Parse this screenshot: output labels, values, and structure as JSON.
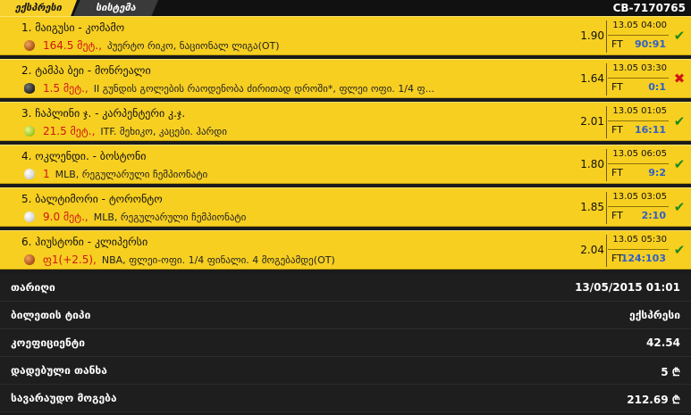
{
  "tabs": {
    "express": "ექსპრესი",
    "system": "სისტემა"
  },
  "ticket_id": "CB-7170765",
  "bets": [
    {
      "match": "1. მაიგუსი - კომამო",
      "sport": "basketball",
      "pick": "164.5 მეტ.,",
      "desc": "პუერტო რიკო, ნაციონალ ლიგა(OT)",
      "odds": "1.90",
      "datetime": "13.05 04:00",
      "ft": "FT",
      "score": "90:91",
      "status": "win",
      "status_icon": "✔"
    },
    {
      "match": "2. ტამპა ბეი - მონრეალი",
      "sport": "hockey",
      "pick": "1.5 მეტ.,",
      "desc": "II გუნდის გოლების რაოდენობა ძირითად დროში*, ფლეი ოფი. 1/4 ფ...",
      "odds": "1.64",
      "datetime": "13.05 03:30",
      "ft": "FT",
      "score": "0:1",
      "status": "lose",
      "status_icon": "✖"
    },
    {
      "match": "3. ჩაპლინი ჯ. - კარპენტერი კ.ჯ.",
      "sport": "tennis",
      "pick": "21.5 მეტ.,",
      "desc": "ITF. მეხიკო, კაცები. ჰარდი",
      "odds": "2.01",
      "datetime": "13.05 01:05",
      "ft": "FT",
      "score": "16:11",
      "status": "win",
      "status_icon": "✔"
    },
    {
      "match": "4. ოკლენდი. - ბოსტონი",
      "sport": "baseball",
      "pick": "1",
      "desc": "MLB, რეგულარული ჩემპიონატი",
      "odds": "1.80",
      "datetime": "13.05 06:05",
      "ft": "FT",
      "score": "9:2",
      "status": "win",
      "status_icon": "✔"
    },
    {
      "match": "5. ბალტიმორი - ტორონტო",
      "sport": "baseball",
      "pick": "9.0 მეტ.,",
      "desc": "MLB, რეგულარული ჩემპიონატი",
      "odds": "1.85",
      "datetime": "13.05 03:05",
      "ft": "FT",
      "score": "2:10",
      "status": "win",
      "status_icon": "✔"
    },
    {
      "match": "6. ჰიუსტონი - კლიპერსი",
      "sport": "basketball",
      "pick": "ფ1(+2.5),",
      "desc": "NBA, ფლეი-ოფი. 1/4 ფინალი. 4 მოგებამდე(OT)",
      "odds": "2.04",
      "datetime": "13.05 05:30",
      "ft": "FT",
      "score": "124:103",
      "status": "win",
      "status_icon": "✔"
    }
  ],
  "summary": [
    {
      "label": "თარიღი",
      "value": "13/05/2015 01:01"
    },
    {
      "label": "ბილეთის ტიპი",
      "value": "ექსპრესი"
    },
    {
      "label": "კოეფიციენტი",
      "value": "42.54"
    },
    {
      "label": "დადებული თანხა",
      "value": "5 ₾"
    },
    {
      "label": "სავარაუდო მოგება",
      "value": "212.69 ₾"
    }
  ]
}
